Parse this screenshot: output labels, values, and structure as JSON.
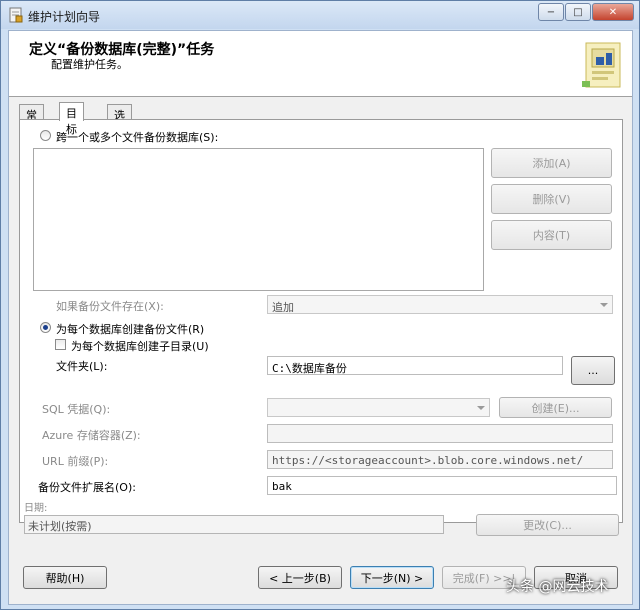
{
  "window": {
    "title": "维护计划向导",
    "minimize": "−",
    "maximize": "□",
    "close": "✕"
  },
  "header": {
    "title": "定义“备份数据库(完整)”任务",
    "subtitle": "配置维护任务。"
  },
  "tabs": [
    {
      "label": "常规"
    },
    {
      "label": "目标"
    },
    {
      "label": "选项"
    }
  ],
  "destination": {
    "across_files_label": "跨一个或多个文件备份数据库(S):",
    "add_button": "添加(A)",
    "remove_button": "删除(V)",
    "contents_button": "内容(T)",
    "if_exists_label": "如果备份文件存在(X):",
    "if_exists_value": "追加",
    "per_db_label": "为每个数据库创建备份文件(R)",
    "subdir_label": "为每个数据库创建子目录(U)",
    "folder_label": "文件夹(L):",
    "folder_value": "C:\\数据库备份",
    "browse_button": "...",
    "sql_credential_label": "SQL 凭据(Q):",
    "create_button": "创建(E)...",
    "azure_container_label": "Azure 存储容器(Z):",
    "url_prefix_label": "URL 前缀(P):",
    "url_prefix_value": "https://<storageaccount>.blob.core.windows.net/",
    "ext_label": "备份文件扩展名(O):",
    "ext_value": "bak"
  },
  "schedule": {
    "label": "日期:",
    "value": "未计划(按需)",
    "change_button": "更改(C)..."
  },
  "footer": {
    "help": "帮助(H)",
    "back": "< 上一步(B)",
    "next": "下一步(N) >",
    "finish": "完成(F) >>|",
    "cancel": "取消"
  },
  "watermark": "头条 @网云技术",
  "colors": {
    "accent": "#3c7fb1",
    "disabled": "#8a8a8a"
  }
}
